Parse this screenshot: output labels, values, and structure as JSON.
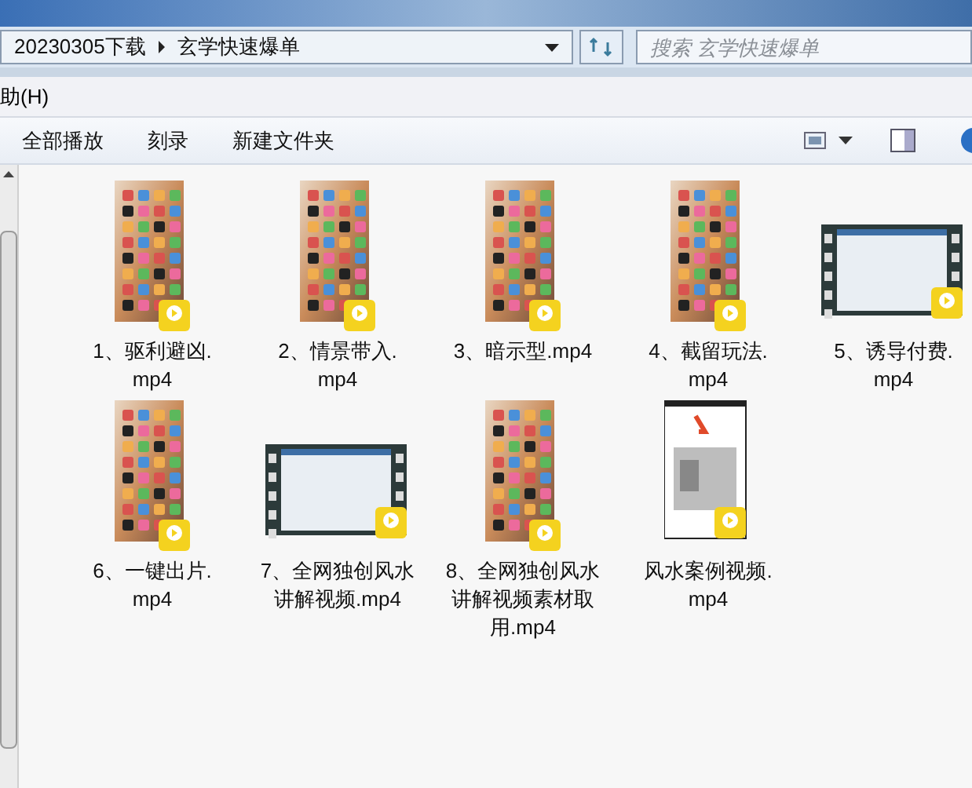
{
  "address_bar": {
    "crumbs": [
      "20230305下载",
      "玄学快速爆单"
    ]
  },
  "search": {
    "placeholder": "搜索 玄学快速爆单"
  },
  "menu_bar": {
    "items": [
      "助(H)"
    ]
  },
  "toolbar": {
    "buttons": [
      "全部播放",
      "刻录",
      "新建文件夹"
    ]
  },
  "files": [
    {
      "kind": "phone",
      "lines": [
        "1、驱利避凶.",
        "mp4"
      ]
    },
    {
      "kind": "phone",
      "lines": [
        "2、情景带入.",
        "mp4"
      ]
    },
    {
      "kind": "phone",
      "lines": [
        "3、暗示型.mp4"
      ]
    },
    {
      "kind": "phone",
      "lines": [
        "4、截留玩法.",
        "mp4"
      ]
    },
    {
      "kind": "film",
      "lines": [
        "5、诱导付费.",
        "mp4"
      ]
    },
    {
      "kind": "phone",
      "lines": [
        "6、一键出片.",
        "mp4"
      ]
    },
    {
      "kind": "film",
      "lines": [
        "7、全网独创风水",
        "讲解视频.mp4"
      ]
    },
    {
      "kind": "phone",
      "lines": [
        "8、全网独创风水",
        "讲解视频素材取",
        "用.mp4"
      ]
    },
    {
      "kind": "photo",
      "lines": [
        "风水案例视频.",
        "mp4"
      ]
    }
  ]
}
